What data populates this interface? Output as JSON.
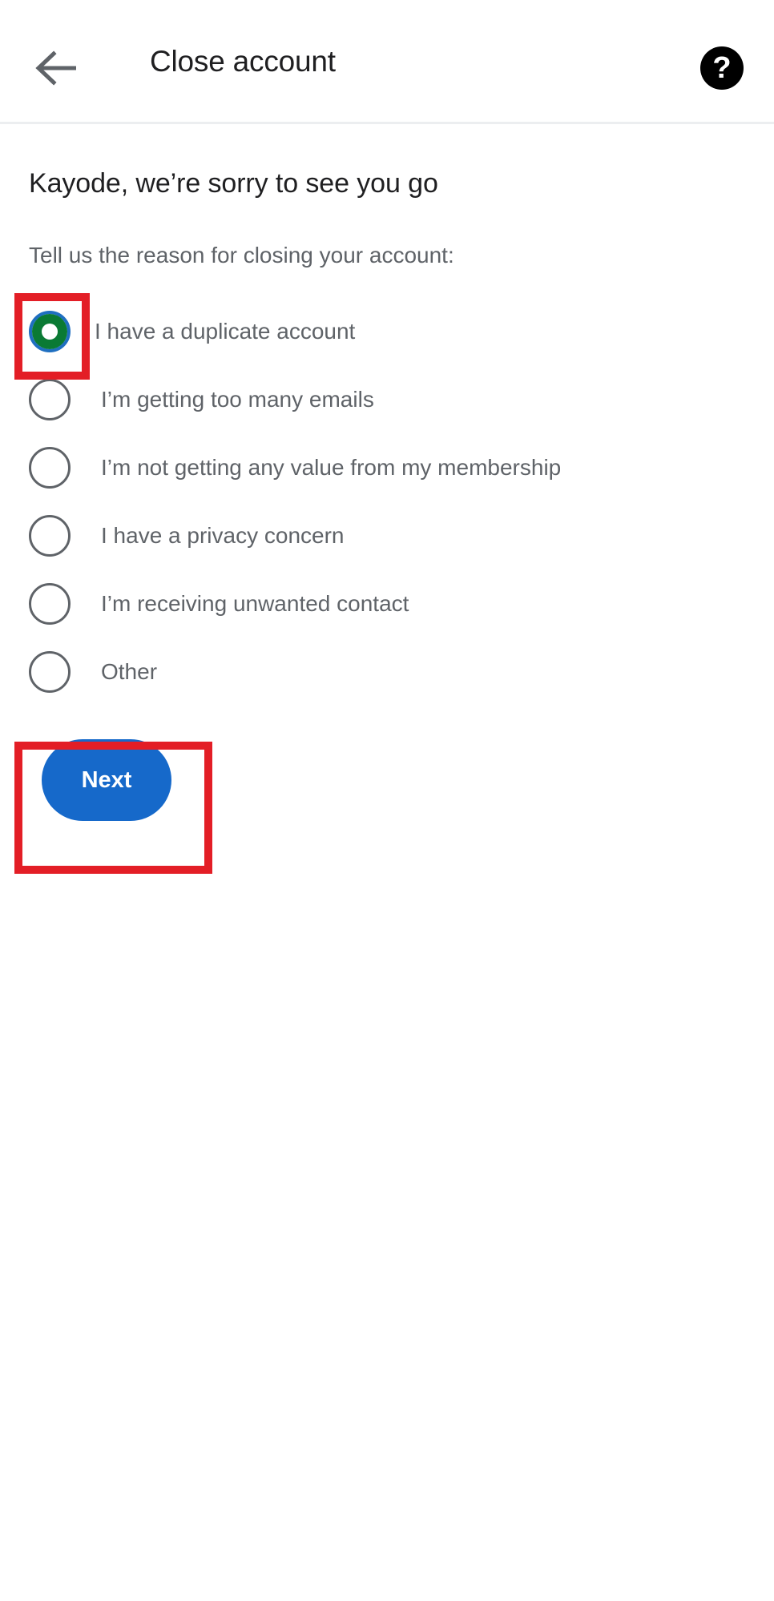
{
  "appbar": {
    "back_icon": "arrow-left-icon",
    "title": "Close account",
    "help_icon": "help-question-icon",
    "help_glyph": "?"
  },
  "main": {
    "headline": "Kayode, we’re sorry to see you go",
    "subtitle": "Tell us the reason for closing your account:",
    "options": [
      {
        "label": "I have a duplicate account",
        "selected": true
      },
      {
        "label": "I’m getting too many emails",
        "selected": false
      },
      {
        "label": "I’m not getting any value from my membership",
        "selected": false
      },
      {
        "label": "I have a privacy concern",
        "selected": false
      },
      {
        "label": "I’m receiving unwanted contact",
        "selected": false
      },
      {
        "label": "Other",
        "selected": false
      }
    ],
    "next_label": "Next"
  },
  "annotations": [
    {
      "name": "selected-radio-highlight",
      "color": "#e31e26"
    },
    {
      "name": "next-button-highlight",
      "color": "#e31e26"
    }
  ],
  "colors": {
    "accent_blue": "#1669ca",
    "selected_green": "#0a7a34",
    "selected_ring_blue": "#1f6fc0",
    "text_primary": "#1f1f21",
    "text_secondary": "#5f6368",
    "annotation_red": "#e31e26",
    "divider": "#eceef0"
  }
}
